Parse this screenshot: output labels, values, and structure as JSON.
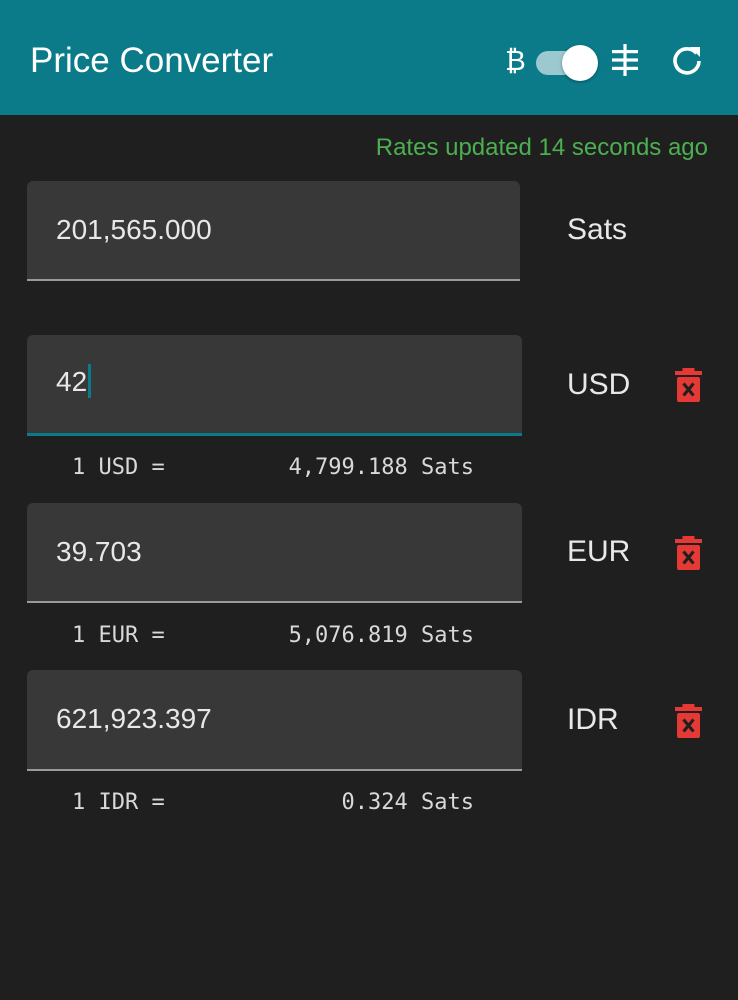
{
  "app": {
    "title": "Price Converter"
  },
  "toolbar": {
    "btc_symbol": "₿",
    "toggle_on": true,
    "sats_symbol_icon": "sats-icon",
    "refresh_icon": "refresh-icon"
  },
  "status": {
    "text": "Rates updated 14 seconds ago",
    "color": "#4caf50"
  },
  "colors": {
    "accent": "#0b7b8a",
    "background": "#1f1f1f",
    "field": "#383838",
    "delete": "#e53935"
  },
  "base": {
    "value": "201,565.000",
    "unit": "Sats"
  },
  "currencies": [
    {
      "value": "42",
      "code": "USD",
      "rate_left": "1 USD =",
      "rate_right": "4,799.188 Sats",
      "focused": true
    },
    {
      "value": "39.703",
      "code": "EUR",
      "rate_left": "1 EUR =",
      "rate_right": "5,076.819 Sats",
      "focused": false
    },
    {
      "value": "621,923.397",
      "code": "IDR",
      "rate_left": "1 IDR =",
      "rate_right": "0.324 Sats",
      "focused": false
    }
  ]
}
